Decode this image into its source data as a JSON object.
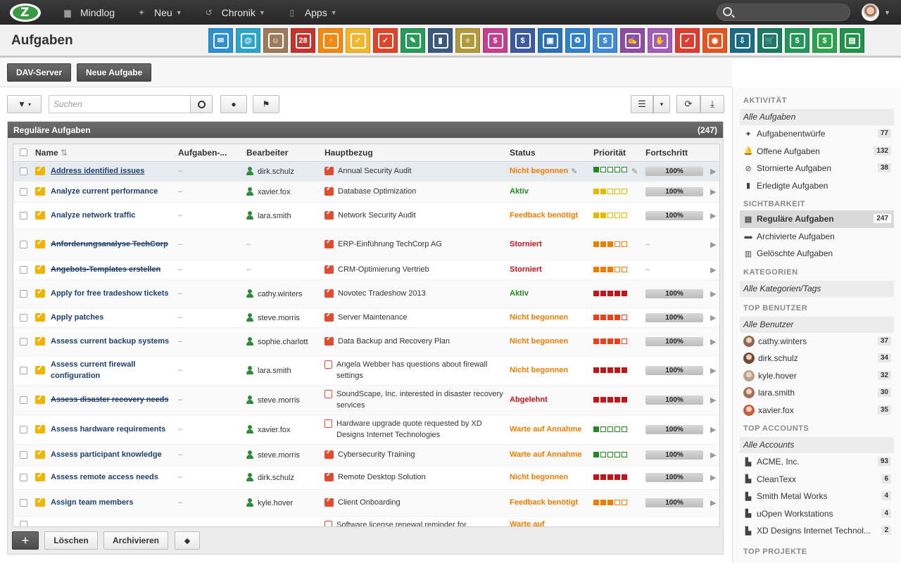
{
  "topbar": {
    "nav": [
      {
        "label": "Mindlog",
        "icon": "chat-icon",
        "caret": false
      },
      {
        "label": "Neu",
        "icon": "sparkle-icon",
        "caret": true
      },
      {
        "label": "Chronik",
        "icon": "history-icon",
        "caret": true
      },
      {
        "label": "Apps",
        "icon": "tablet-icon",
        "caret": true
      }
    ]
  },
  "header": {
    "title": "Aufgaben",
    "apps": [
      {
        "name": "mail-app",
        "color": "#2e8fd1",
        "glyph": "✉"
      },
      {
        "name": "email-app",
        "color": "#2aa6c9",
        "glyph": "@"
      },
      {
        "name": "contacts-app",
        "color": "#9c7b5b",
        "glyph": "☺"
      },
      {
        "name": "calendar-app",
        "color": "#c4342d",
        "glyph": "28"
      },
      {
        "name": "timer-app",
        "color": "#f08a12",
        "glyph": "◔"
      },
      {
        "name": "tasks-app",
        "color": "#f0b72b",
        "glyph": "✓"
      },
      {
        "name": "projects-app",
        "color": "#e0452a",
        "glyph": "✓"
      },
      {
        "name": "notes-app",
        "color": "#2a9a5b",
        "glyph": "✎"
      },
      {
        "name": "bookmarks-app",
        "color": "#3a5a7c",
        "glyph": "▮"
      },
      {
        "name": "documents-app",
        "color": "#b09a3a",
        "glyph": "≡"
      },
      {
        "name": "desk-app",
        "color": "#c43f8f",
        "glyph": "$"
      },
      {
        "name": "finance-app",
        "color": "#3d5a9c",
        "glyph": "$"
      },
      {
        "name": "delivery-app",
        "color": "#2b72b5",
        "glyph": "▣"
      },
      {
        "name": "support-app",
        "color": "#2f82c7",
        "glyph": "♻"
      },
      {
        "name": "budget-app",
        "color": "#3f8ad6",
        "glyph": "$"
      },
      {
        "name": "contracts-app",
        "color": "#8e4ea0",
        "glyph": "✍"
      },
      {
        "name": "deals-app",
        "color": "#a25eb6",
        "glyph": "✋"
      },
      {
        "name": "pdf-app",
        "color": "#df3b2e",
        "glyph": "✓"
      },
      {
        "name": "broadcast-app",
        "color": "#e5551f",
        "glyph": "◉"
      },
      {
        "name": "download-app",
        "color": "#1c6b86",
        "glyph": "⇩"
      },
      {
        "name": "shop-app",
        "color": "#1d7a62",
        "glyph": "🛒"
      },
      {
        "name": "cash-app",
        "color": "#24965a",
        "glyph": "$"
      },
      {
        "name": "pricing-app",
        "color": "#2ea34f",
        "glyph": "$"
      },
      {
        "name": "database-app",
        "color": "#21924a",
        "glyph": "▤"
      }
    ]
  },
  "buttons": {
    "dav": "DAV-Server",
    "new_task": "Neue Aufgabe",
    "delete": "Löschen",
    "archive": "Archivieren",
    "add": "+"
  },
  "search": {
    "placeholder": "Suchen"
  },
  "panel": {
    "title": "Reguläre Aufgaben",
    "count": "(247)"
  },
  "columns": [
    "Name",
    "Aufgaben-...",
    "Bearbeiter",
    "Hauptbezug",
    "Status",
    "Priorität",
    "Fortschritt"
  ],
  "rows": [
    {
      "name": "Address identified issues",
      "style": "link",
      "assignee": "dirk.schulz",
      "ref": "Annual Security Audit",
      "ref_type": "project",
      "status": "Nicht begonnen",
      "status_color": "orange",
      "prio": 1,
      "prio_color": "#1f8a1f",
      "progress": "100%",
      "selected": true,
      "edit": true
    },
    {
      "name": "Analyze current performance",
      "style": "",
      "assignee": "xavier.fox",
      "ref": "Database Optimization",
      "ref_type": "project",
      "status": "Aktiv",
      "status_color": "green",
      "prio": 2,
      "prio_color": "#e6b800",
      "progress": "100%"
    },
    {
      "name": "Analyze network traffic",
      "style": "",
      "assignee": "lara.smith",
      "ref": "Network Security Audit",
      "ref_type": "project",
      "status": "Feedback benötigt",
      "status_color": "orange",
      "prio": 2,
      "prio_color": "#e6b800",
      "progress": "100%"
    },
    {
      "name": "Anforderungsanalyse TechCorp",
      "style": "strike",
      "assignee": "–",
      "ref": "ERP-Einführung TechCorp AG",
      "ref_type": "project",
      "status": "Storniert",
      "status_color": "red",
      "prio": 3,
      "prio_color": "#ee7c00",
      "progress": "–"
    },
    {
      "name": "Angebots-Templates erstellen",
      "style": "strike",
      "assignee": "–",
      "ref": "CRM-Optimierung Vertrieb",
      "ref_type": "project",
      "status": "Storniert",
      "status_color": "red",
      "prio": 3,
      "prio_color": "#ee7c00",
      "progress": "–"
    },
    {
      "name": "Apply for free tradeshow tickets",
      "style": "",
      "assignee": "cathy.winters",
      "ref": "Novotec Tradeshow 2013",
      "ref_type": "project",
      "status": "Aktiv",
      "status_color": "green",
      "prio": 5,
      "prio_color": "#c0161a",
      "progress": "100%"
    },
    {
      "name": "Apply patches",
      "style": "",
      "assignee": "steve.morris",
      "ref": "Server Maintenance",
      "ref_type": "project",
      "status": "Nicht begonnen",
      "status_color": "orange",
      "prio": 4,
      "prio_color": "#e8421a",
      "progress": "100%"
    },
    {
      "name": "Assess current backup systems",
      "style": "",
      "assignee": "sophie.charlott",
      "ref": "Data Backup and Recovery Plan",
      "ref_type": "project",
      "status": "Nicht begonnen",
      "status_color": "orange",
      "prio": 4,
      "prio_color": "#e8421a",
      "progress": "100%"
    },
    {
      "name": "Assess current firewall configuration",
      "style": "",
      "assignee": "lara.smith",
      "ref": "Angela Webber has questions about firewall settings",
      "ref_type": "doc",
      "status": "Nicht begonnen",
      "status_color": "orange",
      "prio": 5,
      "prio_color": "#c0161a",
      "progress": "100%"
    },
    {
      "name": "Assess disaster recovery needs",
      "style": "strike",
      "assignee": "steve.morris",
      "ref": "SoundScape, Inc. interested in disaster recovery services",
      "ref_type": "doc",
      "status": "Abgelehnt",
      "status_color": "red",
      "prio": 5,
      "prio_color": "#c0161a",
      "progress": "100%"
    },
    {
      "name": "Assess hardware requirements",
      "style": "",
      "assignee": "xavier.fox",
      "ref": "Hardware upgrade quote requested by XD Designs Internet Technologies",
      "ref_type": "doc",
      "status": "Warte auf Annahme",
      "status_color": "orange",
      "prio": 1,
      "prio_color": "#1f8a1f",
      "progress": "100%"
    },
    {
      "name": "Assess participant knowledge",
      "style": "",
      "assignee": "steve.morris",
      "ref": "Cybersecurity Training",
      "ref_type": "project",
      "status": "Warte auf Annahme",
      "status_color": "orange",
      "prio": 1,
      "prio_color": "#1f8a1f",
      "progress": "100%"
    },
    {
      "name": "Assess remote access needs",
      "style": "",
      "assignee": "dirk.schulz",
      "ref": "Remote Desktop Solution",
      "ref_type": "project",
      "status": "Nicht begonnen",
      "status_color": "orange",
      "prio": 5,
      "prio_color": "#c0161a",
      "progress": "100%"
    },
    {
      "name": "Assign team members",
      "style": "",
      "assignee": "kyle.hover",
      "ref": "Client Onboarding",
      "ref_type": "project",
      "status": "Feedback benötigt",
      "status_color": "orange",
      "prio": 3,
      "prio_color": "#ee7c00",
      "progress": "100%"
    },
    {
      "name": "",
      "style": "",
      "assignee": "",
      "ref": "Software license renewal reminder for",
      "ref_type": "doc",
      "status": "Warte auf",
      "status_color": "orange",
      "prio": 0,
      "prio_color": "#ccc",
      "progress": ""
    }
  ],
  "sidebar": {
    "activity": {
      "heading": "AKTIVITÄT",
      "all": "Alle Aufgaben",
      "items": [
        {
          "label": "Aufgabenentwürfe",
          "count": "77",
          "icon": "✦"
        },
        {
          "label": "Offene Aufgaben",
          "count": "132",
          "icon": "🔔"
        },
        {
          "label": "Stornierte Aufgaben",
          "count": "38",
          "icon": "⊘"
        },
        {
          "label": "Erledigte Aufgaben",
          "count": "",
          "icon": "▮"
        }
      ]
    },
    "visibility": {
      "heading": "SICHTBARKEIT",
      "items": [
        {
          "label": "Reguläre Aufgaben",
          "count": "247",
          "icon": "▤",
          "active": true
        },
        {
          "label": "Archivierte Aufgaben",
          "count": "",
          "icon": "▬"
        },
        {
          "label": "Gelöschte Aufgaben",
          "count": "",
          "icon": "▥"
        }
      ]
    },
    "categories": {
      "heading": "KATEGORIEN",
      "all": "Alle Kategorien/Tags"
    },
    "top_users": {
      "heading": "TOP BENUTZER",
      "all": "Alle Benutzer",
      "items": [
        {
          "label": "cathy.winters",
          "count": "37",
          "color": "#8a6a55"
        },
        {
          "label": "dirk.schulz",
          "count": "34",
          "color": "#6b4a38"
        },
        {
          "label": "kyle.hover",
          "count": "32",
          "color": "#b8a090"
        },
        {
          "label": "lara.smith",
          "count": "30",
          "color": "#a0705a"
        },
        {
          "label": "xavier.fox",
          "count": "35",
          "color": "#c06040"
        }
      ]
    },
    "top_accounts": {
      "heading": "TOP ACCOUNTS",
      "all": "Alle Accounts",
      "items": [
        {
          "label": "ACME, Inc.",
          "count": "93"
        },
        {
          "label": "CleanTexx",
          "count": "6"
        },
        {
          "label": "Smith Metal Works",
          "count": "4"
        },
        {
          "label": "uOpen Workstations",
          "count": "4"
        },
        {
          "label": "XD Designs Internet Technol...",
          "count": "2"
        }
      ]
    },
    "top_projects": {
      "heading": "TOP PROJEKTE"
    }
  }
}
